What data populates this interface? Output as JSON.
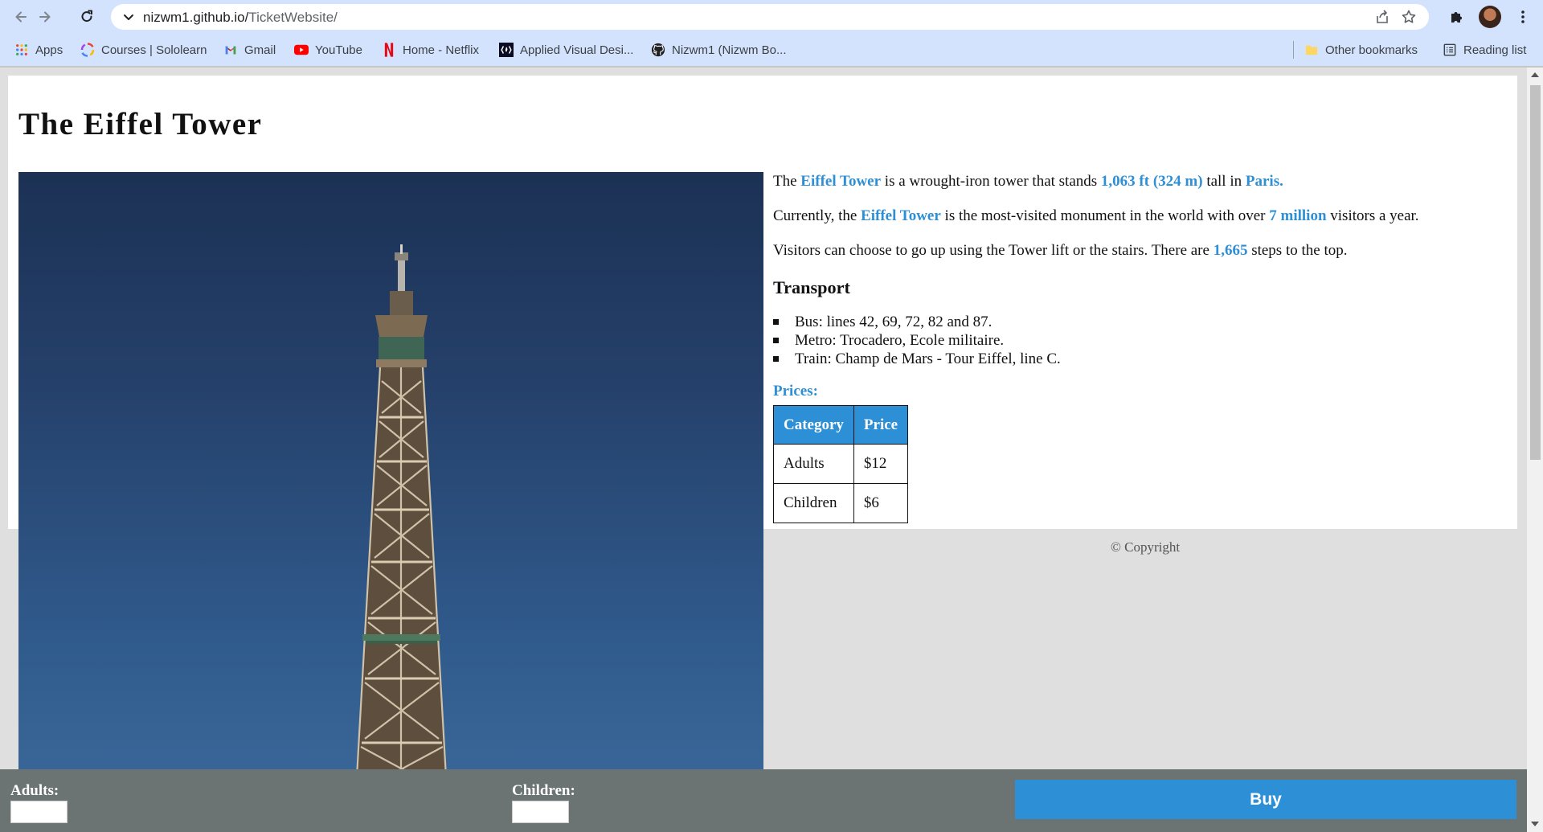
{
  "browser": {
    "url_host": "nizwm1.github.io/",
    "url_path": "TicketWebsite/",
    "bookmarks": [
      {
        "label": "Apps",
        "icon": "apps-grid-icon"
      },
      {
        "label": "Courses | Sololearn",
        "icon": "sololearn-icon"
      },
      {
        "label": "Gmail",
        "icon": "gmail-icon"
      },
      {
        "label": "YouTube",
        "icon": "youtube-icon"
      },
      {
        "label": "Home - Netflix",
        "icon": "netflix-icon"
      },
      {
        "label": "Applied Visual Desi...",
        "icon": "freecodecamp-icon"
      },
      {
        "label": "Nizwm1 (Nizwm Bo...",
        "icon": "github-icon"
      }
    ],
    "other_bookmarks": "Other bookmarks",
    "reading_list": "Reading list"
  },
  "page": {
    "title": "The Eiffel Tower",
    "p1": {
      "a": "The ",
      "b": "Eiffel Tower",
      "c": " is a wrought-iron tower that stands ",
      "d": "1,063 ft (324 m)",
      "e": " tall in ",
      "f": "Paris."
    },
    "p2": {
      "a": "Currently, the ",
      "b": "Eiffel Tower",
      "c": " is the most-visited monument in the world with over ",
      "d": "7 million",
      "e": " visitors a year."
    },
    "p3": {
      "a": "Visitors can choose to go up using the Tower lift or the stairs. There are ",
      "b": "1,665",
      "c": " steps to the top."
    },
    "transport_heading": "Transport",
    "transport": [
      "Bus: lines 42, 69, 72, 82 and 87.",
      "Metro: Trocadero, Ecole militaire.",
      "Train: Champ de Mars - Tour Eiffel, line C."
    ],
    "prices_label": "Prices:",
    "table": {
      "headers": [
        "Category",
        "Price"
      ],
      "rows": [
        [
          "Adults",
          "$12"
        ],
        [
          "Children",
          "$6"
        ]
      ]
    },
    "copyright": "© Copyright"
  },
  "footer": {
    "adults_label": "Adults:",
    "children_label": "Children:",
    "buy_label": "Buy"
  },
  "colors": {
    "accent": "#2d8fd6",
    "footer_bar": "#6b7373",
    "page_background": "#dfdfdf",
    "chrome": "#d3e3fd"
  }
}
